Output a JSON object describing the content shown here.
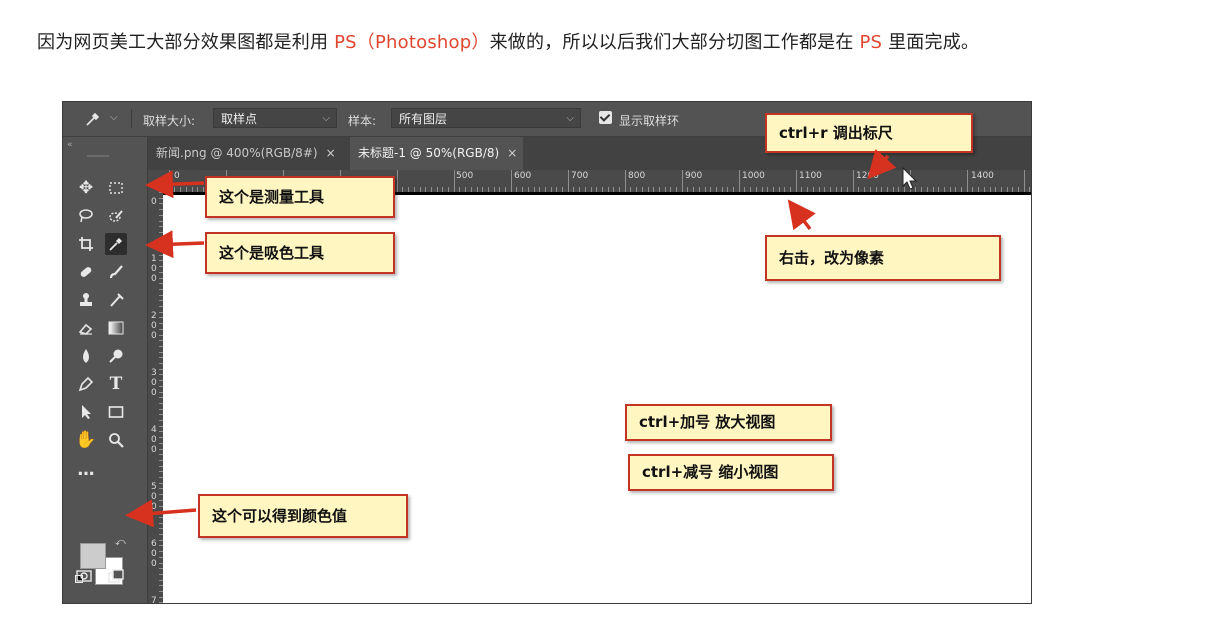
{
  "intro": {
    "part1": "因为网页美工大部分效果图都是利用 ",
    "ps_full": "PS（Photoshop）",
    "part2": "来做的，所以以后我们大部分切图工作都是在 ",
    "ps_short": "PS",
    "part3": " 里面完成。"
  },
  "options_bar": {
    "sample_size_label": "取样大小:",
    "sample_size_value": "取样点",
    "sample_label": "样本:",
    "sample_value": "所有图层",
    "show_ring_label": "显示取样环",
    "show_ring_checked": true
  },
  "tabs": [
    {
      "label": "新闻.png @ 400%(RGB/8#)",
      "close": "×",
      "active": false
    },
    {
      "label": "未标题-1 @ 50%(RGB/8)",
      "close": "×",
      "active": true
    }
  ],
  "ruler": {
    "h_labels": [
      "0",
      "500",
      "600",
      "700",
      "800",
      "900",
      "1000",
      "1100",
      "1200",
      "1400"
    ],
    "v_labels": [
      "0",
      "1 0 0",
      "2 0 0",
      "3 0 0",
      "4 0 0",
      "5 0 0",
      "6 0 0",
      "7"
    ]
  },
  "toolbar": {
    "more_label": "…"
  },
  "callouts": {
    "measure_tool": "这个是测量工具",
    "eyedropper_tool": "这个是吸色工具",
    "color_value": "这个可以得到颜色值",
    "ruler_shortcut": "ctrl+r 调出标尺",
    "right_click_pixels": "右击，改为像素",
    "zoom_in": "ctrl+加号 放大视图",
    "zoom_out": "ctrl+减号 缩小视图"
  },
  "colors": {
    "accent": "#e0462f",
    "callout_bg": "#fff6c2",
    "callout_border": "#c43425",
    "ps_panel": "#535353",
    "ps_dark": "#424242"
  }
}
